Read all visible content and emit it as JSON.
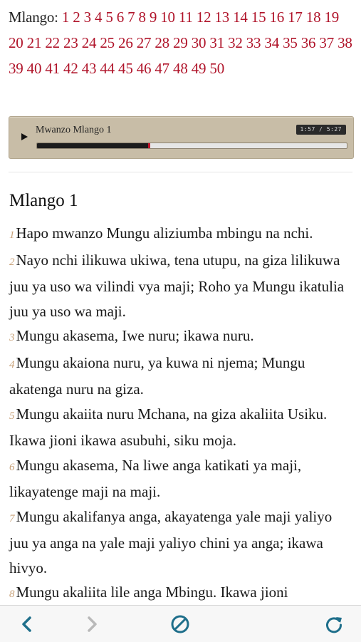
{
  "chapter_nav": {
    "label": "Mlango:",
    "chapters": [
      "1",
      "2",
      "3",
      "4",
      "5",
      "6",
      "7",
      "8",
      "9",
      "10",
      "11",
      "12",
      "13",
      "14",
      "15",
      "16",
      "17",
      "18",
      "19",
      "20",
      "21",
      "22",
      "23",
      "24",
      "25",
      "26",
      "27",
      "28",
      "29",
      "30",
      "31",
      "32",
      "33",
      "34",
      "35",
      "36",
      "37",
      "38",
      "39",
      "40",
      "41",
      "42",
      "43",
      "44",
      "45",
      "46",
      "47",
      "48",
      "49",
      "50"
    ]
  },
  "player": {
    "title": "Mwanzo Mlango 1",
    "time": "1:57 / 5:27",
    "progress": 0.36,
    "play_icon": "play-icon"
  },
  "chapter_heading": "Mlango 1",
  "verses": [
    {
      "num": "1",
      "text": "Hapo mwanzo Mungu aliziumba mbingu na nchi."
    },
    {
      "num": "2",
      "text": "Nayo nchi ilikuwa ukiwa, tena utupu, na giza lilikuwa juu ya uso wa vilindi vya maji; Roho ya Mungu ikatulia juu ya uso wa maji."
    },
    {
      "num": "3",
      "text": "Mungu akasema, Iwe nuru; ikawa nuru."
    },
    {
      "num": "4",
      "text": "Mungu akaiona nuru, ya kuwa ni njema; Mungu akatenga nuru na giza."
    },
    {
      "num": "5",
      "text": "Mungu akaiita nuru Mchana, na giza akaliita Usiku. Ikawa jioni ikawa asubuhi, siku moja."
    },
    {
      "num": "6",
      "text": "Mungu akasema, Na liwe anga katikati ya maji, likayatenge maji na maji."
    },
    {
      "num": "7",
      "text": "Mungu akalifanya anga, akayatenga yale maji yaliyo juu ya anga na yale maji yaliyo chini ya anga; ikawa hivyo."
    },
    {
      "num": "8",
      "text": "Mungu akaliita lile anga Mbingu. Ikawa jioni"
    }
  ],
  "toolbar": {
    "icons": [
      "back-icon",
      "forward-icon",
      "stop-icon",
      "refresh-icon"
    ],
    "active_color": "#1f6f8b",
    "disabled_color": "#b9b9b9"
  }
}
